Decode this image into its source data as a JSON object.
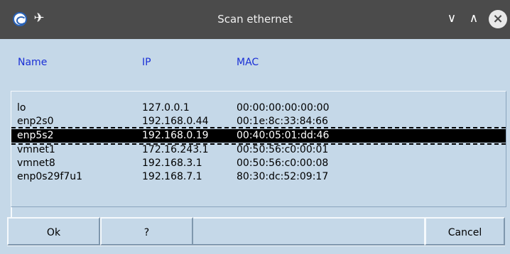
{
  "window": {
    "title": "Scan ethernet"
  },
  "title_bar": {
    "buttons": {
      "minimize": "∨",
      "maximize": "∧",
      "close": "×"
    }
  },
  "columns": {
    "name": "Name",
    "ip": "IP",
    "mac": "MAC"
  },
  "rows": [
    {
      "name": "lo",
      "ip": "127.0.0.1",
      "mac": "00:00:00:00:00:00",
      "selected": false
    },
    {
      "name": "enp2s0",
      "ip": "192.168.0.44",
      "mac": "00:1e:8c:33:84:66",
      "selected": false
    },
    {
      "name": "enp5s2",
      "ip": "192.168.0.19",
      "mac": "00:40:05:01:dd:46",
      "selected": true
    },
    {
      "name": "vmnet1",
      "ip": "172.16.243.1",
      "mac": "00:50:56:c0:00:01",
      "selected": false
    },
    {
      "name": "vmnet8",
      "ip": "192.168.3.1",
      "mac": "00:50:56:c0:00:08",
      "selected": false
    },
    {
      "name": "enp0s29f7u1",
      "ip": "192.168.7.1",
      "mac": "80:30:dc:52:09:17",
      "selected": false
    }
  ],
  "buttons": {
    "ok": "Ok",
    "help": "?",
    "cancel": "Cancel"
  },
  "colors": {
    "header_text": "#1a2fd6",
    "background": "#c5d8e8",
    "titlebar": "#4b4b4b",
    "selection": "#000000"
  }
}
